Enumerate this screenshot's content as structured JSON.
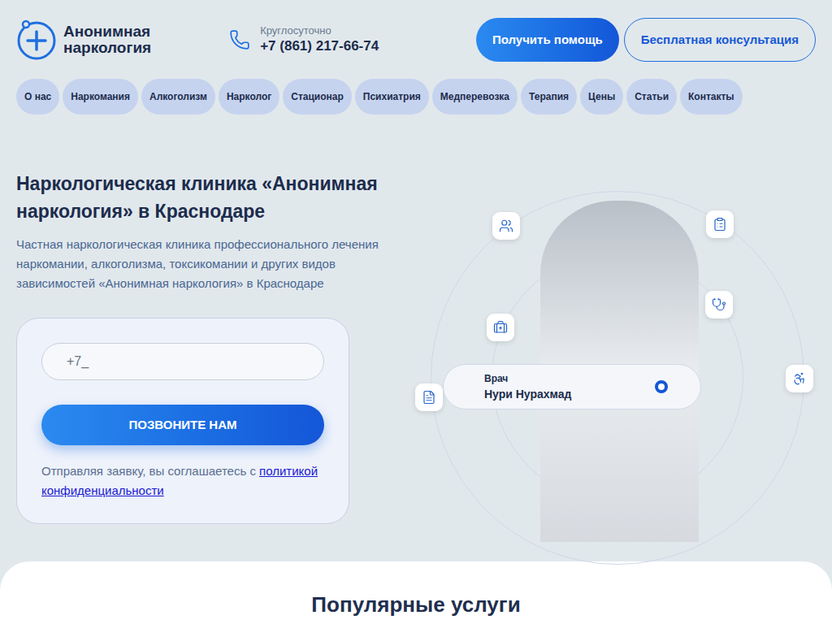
{
  "logo": {
    "line1": "Анонимная",
    "line2": "наркология"
  },
  "contact": {
    "label": "Круглосуточно",
    "phone": "+7 (861) 217-66-74"
  },
  "header_buttons": [
    {
      "label": "Получить помощь",
      "kind": "filled"
    },
    {
      "label": "Бесплатная консультация",
      "kind": "outline"
    }
  ],
  "nav": [
    {
      "label": "О нас"
    },
    {
      "label": "Наркомания"
    },
    {
      "label": "Алкоголизм"
    },
    {
      "label": "Нарколог"
    },
    {
      "label": "Стационар"
    },
    {
      "label": "Психиатрия"
    },
    {
      "label": "Медперевозка"
    },
    {
      "label": "Терапия"
    },
    {
      "label": "Цены"
    },
    {
      "label": "Статьи"
    },
    {
      "label": "Контакты"
    }
  ],
  "hero": {
    "title": "Наркологическая клиника «Анонимная наркология» в Краснодаре",
    "subtitle": "Частная наркологическая клиника профессионального лечения наркомании, алкоголизма, токсикомании и других видов зависимостей «Анонимная наркология» в Краснодаре"
  },
  "form": {
    "phone_placeholder": "+7_",
    "submit": "ПОЗВОНИТЕ НАМ",
    "consent": "Отправляя заявку, вы соглашаетесь с",
    "policy_link": "политикой конфиденциальности"
  },
  "doctor": {
    "role": "Врач",
    "name": "Нури Нурахмад"
  },
  "section": {
    "title": "Популярные услуги"
  }
}
